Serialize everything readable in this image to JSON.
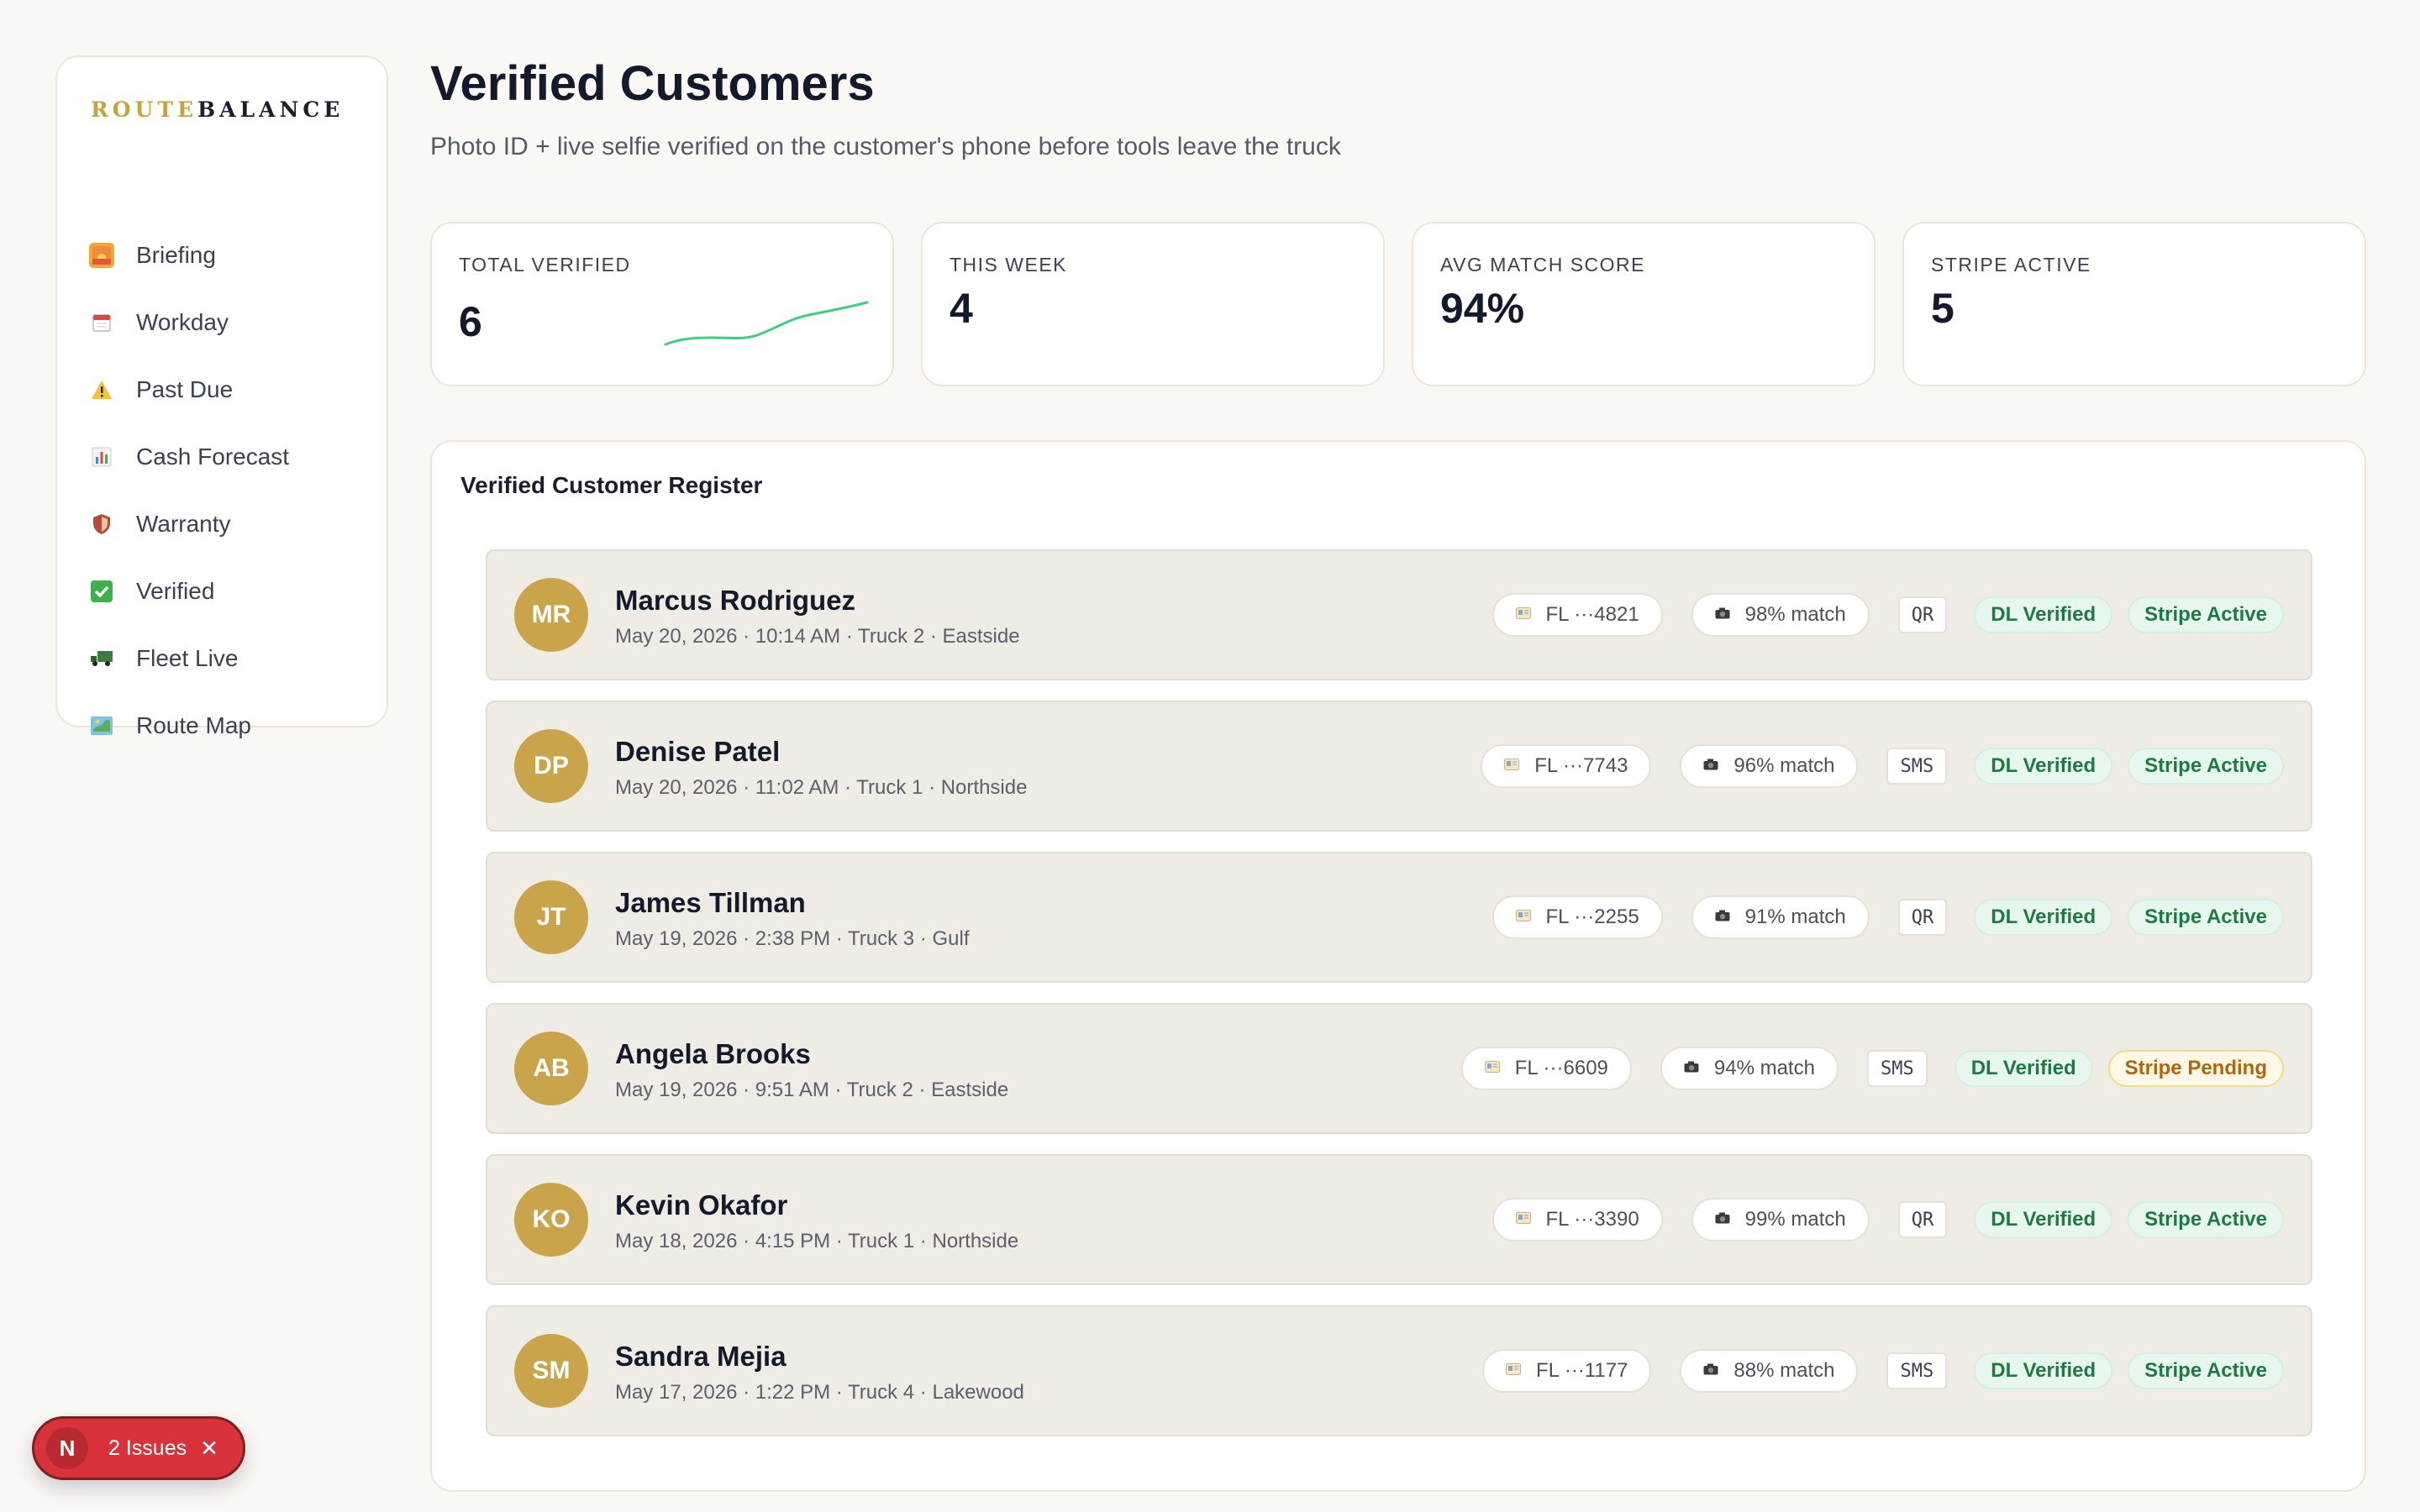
{
  "brand": {
    "part1": "ROUTE",
    "part2": "BALANCE"
  },
  "nav": [
    {
      "label": "Briefing",
      "icon": "sunrise-icon"
    },
    {
      "label": "Workday",
      "icon": "calendar-icon"
    },
    {
      "label": "Past Due",
      "icon": "warning-icon"
    },
    {
      "label": "Cash Forecast",
      "icon": "bar-chart-icon"
    },
    {
      "label": "Warranty",
      "icon": "shield-icon"
    },
    {
      "label": "Verified",
      "icon": "check-box-icon"
    },
    {
      "label": "Fleet Live",
      "icon": "truck-icon"
    },
    {
      "label": "Route Map",
      "icon": "map-icon"
    }
  ],
  "header": {
    "title": "Verified Customers",
    "subtitle": "Photo ID + live selfie verified on the customer's phone before tools leave the truck"
  },
  "stats": [
    {
      "label": "TOTAL VERIFIED",
      "value": "6"
    },
    {
      "label": "THIS WEEK",
      "value": "4"
    },
    {
      "label": "AVG MATCH SCORE",
      "value": "94%"
    },
    {
      "label": "STRIPE ACTIVE",
      "value": "5"
    }
  ],
  "colors": {
    "accent_gold": "#c9a44a",
    "verified_green": "#1e7a45",
    "pending_orange": "#b4640a",
    "sparkline": "#3ecf7e",
    "issues_red": "#d8333a"
  },
  "register": {
    "title": "Verified Customer Register",
    "rows": [
      {
        "initials": "MR",
        "name": "Marcus Rodriguez",
        "meta": "May 20, 2026 · 10:14 AM · Truck 2 · Eastside",
        "id": "FL ···4821",
        "match": "98% match",
        "method": "QR",
        "dl": "DL Verified",
        "stripe": "Stripe Active",
        "stripe_status": "active"
      },
      {
        "initials": "DP",
        "name": "Denise Patel",
        "meta": "May 20, 2026 · 11:02 AM · Truck 1 · Northside",
        "id": "FL ···7743",
        "match": "96% match",
        "method": "SMS",
        "dl": "DL Verified",
        "stripe": "Stripe Active",
        "stripe_status": "active"
      },
      {
        "initials": "JT",
        "name": "James Tillman",
        "meta": "May 19, 2026 · 2:38 PM · Truck 3 · Gulf",
        "id": "FL ···2255",
        "match": "91% match",
        "method": "QR",
        "dl": "DL Verified",
        "stripe": "Stripe Active",
        "stripe_status": "active"
      },
      {
        "initials": "AB",
        "name": "Angela Brooks",
        "meta": "May 19, 2026 · 9:51 AM · Truck 2 · Eastside",
        "id": "FL ···6609",
        "match": "94% match",
        "method": "SMS",
        "dl": "DL Verified",
        "stripe": "Stripe Pending",
        "stripe_status": "pending"
      },
      {
        "initials": "KO",
        "name": "Kevin Okafor",
        "meta": "May 18, 2026 · 4:15 PM · Truck 1 · Northside",
        "id": "FL ···3390",
        "match": "99% match",
        "method": "QR",
        "dl": "DL Verified",
        "stripe": "Stripe Active",
        "stripe_status": "active"
      },
      {
        "initials": "SM",
        "name": "Sandra Mejia",
        "meta": "May 17, 2026 · 1:22 PM · Truck 4 · Lakewood",
        "id": "FL ···1177",
        "match": "88% match",
        "method": "SMS",
        "dl": "DL Verified",
        "stripe": "Stripe Active",
        "stripe_status": "active"
      }
    ]
  },
  "issues_badge": {
    "logo": "N",
    "label": "2 Issues"
  }
}
